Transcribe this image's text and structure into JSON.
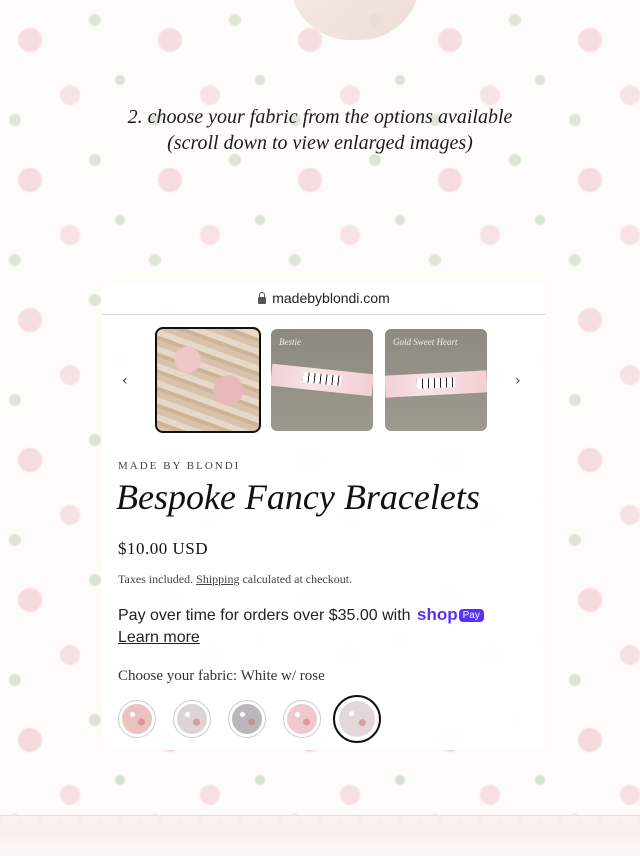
{
  "caption": {
    "line1": "2. choose your fabric from the options available",
    "line2": "(scroll down to view enlarged images)"
  },
  "browser": {
    "url": "madebyblondi.com"
  },
  "carousel": {
    "prev_icon": "chevron-left-icon",
    "next_icon": "chevron-right-icon",
    "prev_glyph": "‹",
    "next_glyph": "›",
    "thumbnails": [
      {
        "label": ""
      },
      {
        "label": "Bestie"
      },
      {
        "label": "Gold Sweet Heart"
      }
    ],
    "selected_index": 0
  },
  "product": {
    "vendor": "MADE BY BLONDI",
    "title": "Bespoke Fancy Bracelets",
    "price": "$10.00 USD",
    "tax_prefix": "Taxes included.",
    "shipping_link": "Shipping",
    "tax_suffix": "calculated at checkout."
  },
  "shop_pay": {
    "text": "Pay over time for orders over $35.00 with",
    "brand": "shop",
    "badge": "Pay",
    "learn_more": "Learn more",
    "brand_color": "#5a31f4"
  },
  "fabric": {
    "label": "Choose your fabric: White w/ rose",
    "swatches": [
      {
        "color": "#e9c3c0"
      },
      {
        "color": "#dcd3d6"
      },
      {
        "color": "#b9b7bc"
      },
      {
        "color": "#f0c9cf"
      },
      {
        "color": "#e4d7d9"
      }
    ],
    "selected_index": 4
  }
}
